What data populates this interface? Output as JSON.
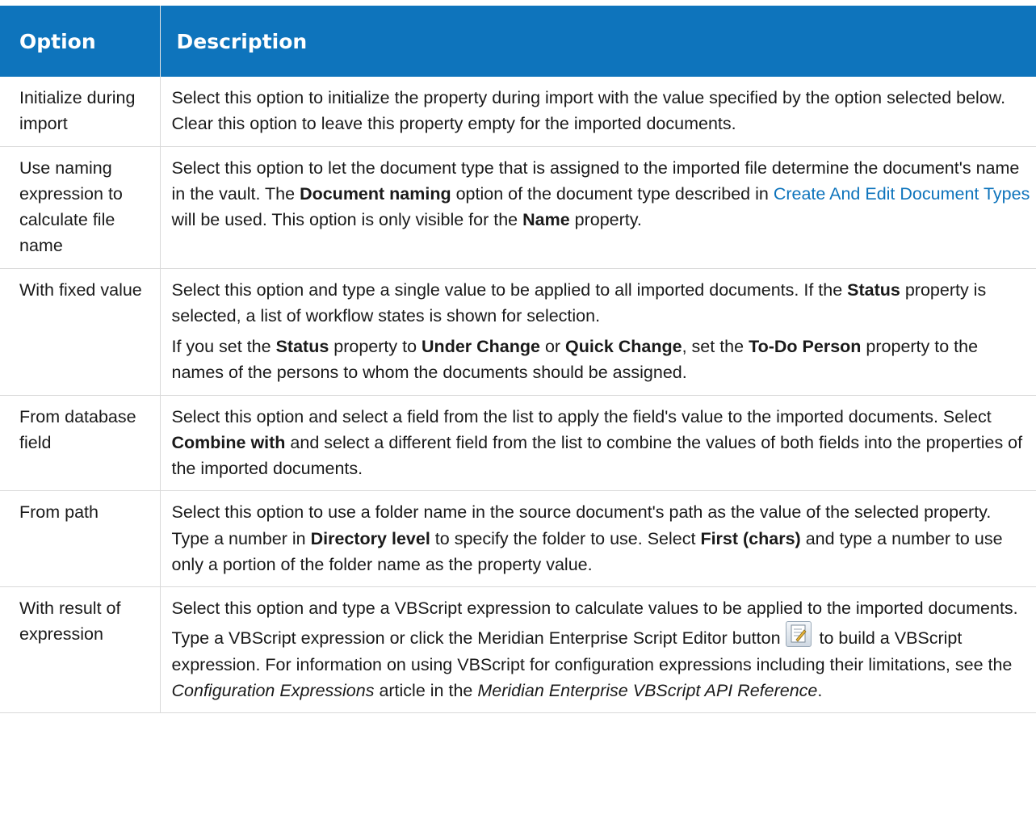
{
  "header": {
    "option": "Option",
    "description": "Description"
  },
  "rows": [
    {
      "option": "Initialize during import",
      "p1": "Select this option to initialize the property during import with the value specified by the option selected below. Clear this option to leave this property empty for the imported documents."
    },
    {
      "option": "Use naming expression to calculate file name",
      "t1": "Select this option to let the document type that is assigned to the imported file determine the document's name in the vault. The ",
      "b1": "Document naming",
      "t2": " option of the document type described in ",
      "link": "Create And Edit Document Types",
      "t3": " will be used. This option is only visible for the ",
      "b2": "Name",
      "t4": " property."
    },
    {
      "option": "With fixed value",
      "p1_t1": "Select this option and type a single value to be applied to all imported documents. If the ",
      "p1_b1": "Status",
      "p1_t2": " property is selected, a list of workflow states is shown for selection.",
      "p2_t1": "If you set the ",
      "p2_b1": "Status",
      "p2_t2": " property to ",
      "p2_b2": "Under Change",
      "p2_t3": " or ",
      "p2_b3": "Quick Change",
      "p2_t4": ", set the ",
      "p2_b4": "To-Do Person",
      "p2_t5": " property to the names of the persons to whom the documents should be assigned."
    },
    {
      "option": "From database field",
      "t1": "Select this option and select a field from the list to apply the field's value to the imported documents. Select ",
      "b1": "Combine with",
      "t2": " and select a different field from the list to combine the values of both fields into the properties of the imported documents."
    },
    {
      "option": "From path",
      "t1": "Select this option to use a folder name in the source document's path as the value of the selected property. Type a number in ",
      "b1": "Directory level",
      "t2": " to specify the folder to use. Select ",
      "b2": "First (chars)",
      "t3": " and type a number to use only a portion of the folder name as the property value."
    },
    {
      "option": "With result of expression",
      "t1": "Select this option and type a VBScript expression to calculate values to be applied to the imported documents. Type a VBScript expression or click the Meridian Enterprise Script Editor button ",
      "icon": "script-editor-icon",
      "t2": " to build a VBScript expression.  For information on using VBScript for configuration expressions including their limitations, see the ",
      "i1": "Configuration Expressions",
      "t3": " article in the ",
      "i2": "Meridian Enterprise VBScript API Reference",
      "t4": "."
    }
  ],
  "colors": {
    "header_bg": "#0e74bc",
    "link": "#0e74bc",
    "border": "#d9d9d9"
  }
}
